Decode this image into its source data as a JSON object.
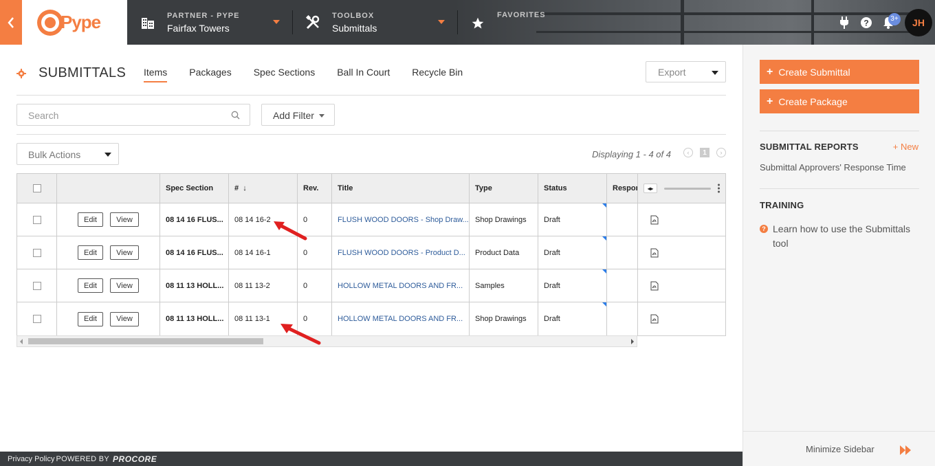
{
  "topbar": {
    "logo_text": "Pype",
    "partner_label": "PARTNER - PYPE",
    "partner_value": "Fairfax Towers",
    "toolbox_label": "TOOLBOX",
    "toolbox_value": "Submittals",
    "favorites_label": "FAVORITES",
    "notification_count": "3+",
    "avatar_initials": "JH"
  },
  "page": {
    "title": "SUBMITTALS",
    "tabs": [
      "Items",
      "Packages",
      "Spec Sections",
      "Ball In Court",
      "Recycle Bin"
    ],
    "export_label": "Export",
    "search_placeholder": "Search",
    "add_filter_label": "Add Filter",
    "bulk_actions_label": "Bulk Actions",
    "displaying_text": "Displaying 1 - 4 of 4",
    "page_number": "1"
  },
  "table": {
    "headers": [
      "",
      "",
      "Spec Section",
      "#",
      "Rev.",
      "Title",
      "Type",
      "Status",
      "Respon"
    ],
    "sort_indicator": "↓",
    "edit_label": "Edit",
    "view_label": "View",
    "rows": [
      {
        "spec": "08 14 16 FLUS...",
        "num": "08 14 16-2",
        "rev": "0",
        "title": "FLUSH WOOD DOORS - Shop Draw...",
        "type": "Shop Drawings",
        "status": "Draft"
      },
      {
        "spec": "08 14 16 FLUS...",
        "num": "08 14 16-1",
        "rev": "0",
        "title": "FLUSH WOOD DOORS - Product D...",
        "type": "Product Data",
        "status": "Draft"
      },
      {
        "spec": "08 11 13 HOLL...",
        "num": "08 11 13-2",
        "rev": "0",
        "title": "HOLLOW METAL DOORS AND FR...",
        "type": "Samples",
        "status": "Draft"
      },
      {
        "spec": "08 11 13 HOLL...",
        "num": "08 11 13-1",
        "rev": "0",
        "title": "HOLLOW METAL DOORS AND FR...",
        "type": "Shop Drawings",
        "status": "Draft"
      }
    ]
  },
  "sidebar": {
    "create_submittal": "Create Submittal",
    "create_package": "Create Package",
    "reports_heading": "SUBMITTAL REPORTS",
    "new_label": "+ New",
    "report_item": "Submittal Approvers' Response Time",
    "training_heading": "TRAINING",
    "training_link": "Learn how to use the Submittals tool",
    "minimize_label": "Minimize Sidebar"
  },
  "footer": {
    "privacy": "Privacy Policy",
    "powered_by": "POWERED BY",
    "brand": "PROCORE"
  },
  "colors": {
    "accent": "#f47e42",
    "topbar": "#3a3d40",
    "link": "#2d5b9a",
    "annotation_arrow": "#e02020"
  }
}
